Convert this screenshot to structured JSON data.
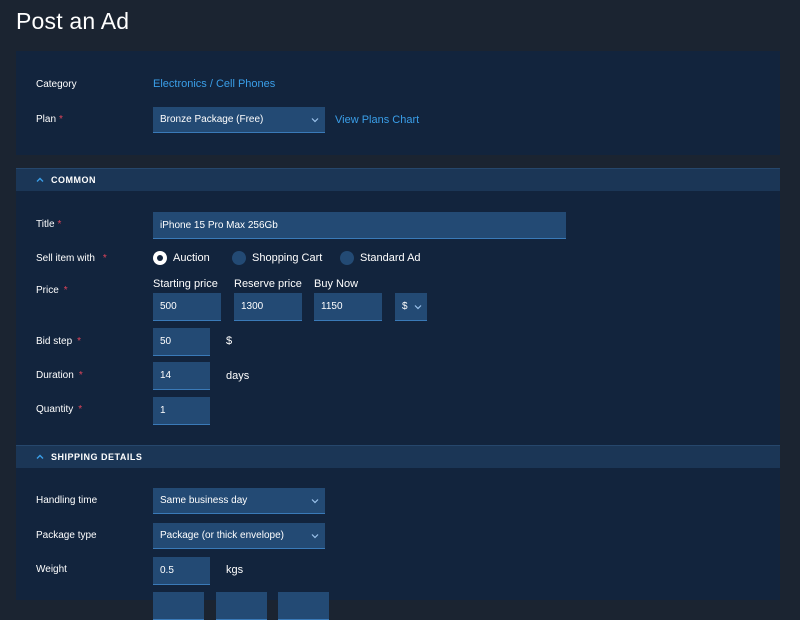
{
  "page": {
    "title": "Post an Ad"
  },
  "top": {
    "category_label": "Category",
    "category_value": "Electronics / Cell Phones",
    "plan_label": "Plan",
    "plan_value": "Bronze Package (Free)",
    "plans_chart_link": "View Plans Chart"
  },
  "sections": {
    "common": "COMMON",
    "shipping": "SHIPPING DETAILS"
  },
  "common": {
    "title_label": "Title",
    "title_value": "iPhone 15 Pro Max 256Gb",
    "sell_label": "Sell item with",
    "sell_options": [
      "Auction",
      "Shopping Cart",
      "Standard Ad"
    ],
    "sell_selected": "Auction",
    "price_label": "Price",
    "price_sublabels": [
      "Starting price",
      "Reserve price",
      "Buy Now"
    ],
    "starting_price": "500",
    "reserve_price": "1300",
    "buy_now_price": "1150",
    "currency": "$",
    "bid_step_label": "Bid step",
    "bid_step": "50",
    "bid_step_unit": "$",
    "duration_label": "Duration",
    "duration": "14",
    "duration_unit": "days",
    "quantity_label": "Quantity",
    "quantity": "1"
  },
  "shipping": {
    "handling_label": "Handling time",
    "handling_value": "Same business day",
    "package_label": "Package type",
    "package_value": "Package (or thick envelope)",
    "weight_label": "Weight",
    "weight_value": "0.5",
    "weight_unit": "kgs"
  },
  "colors": {
    "background": "#1b2431",
    "panel": "#12243d",
    "section_header": "#1b3656",
    "field": "#234a74",
    "link": "#3a9ee8",
    "required": "#e0445a"
  }
}
